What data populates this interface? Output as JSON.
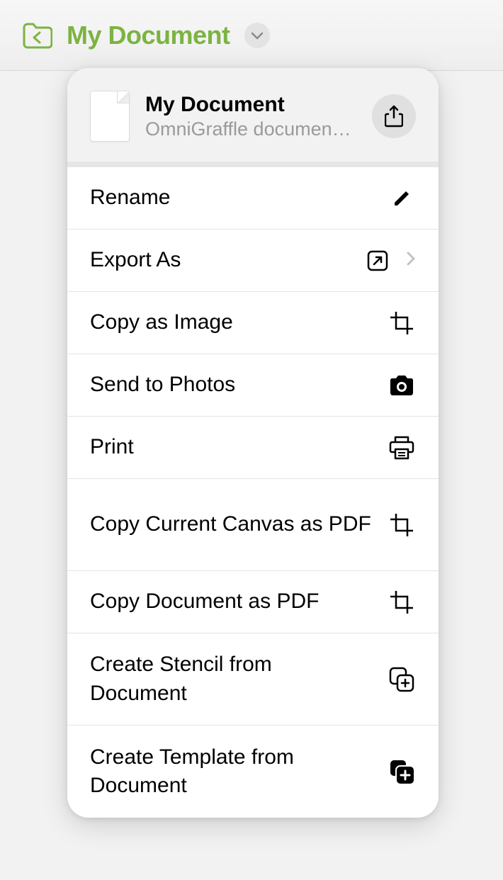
{
  "toolbar": {
    "title": "My Document"
  },
  "popover": {
    "doc_title": "My Document",
    "doc_subtitle": "OmniGraffle document…"
  },
  "menu": {
    "rename": "Rename",
    "export_as": "Export As",
    "copy_as_image": "Copy as Image",
    "send_to_photos": "Send to Photos",
    "print": "Print",
    "copy_canvas_pdf": "Copy Current Canvas as PDF",
    "copy_doc_pdf": "Copy Document as PDF",
    "create_stencil": "Create Stencil from Document",
    "create_template": "Create Template from Document"
  }
}
